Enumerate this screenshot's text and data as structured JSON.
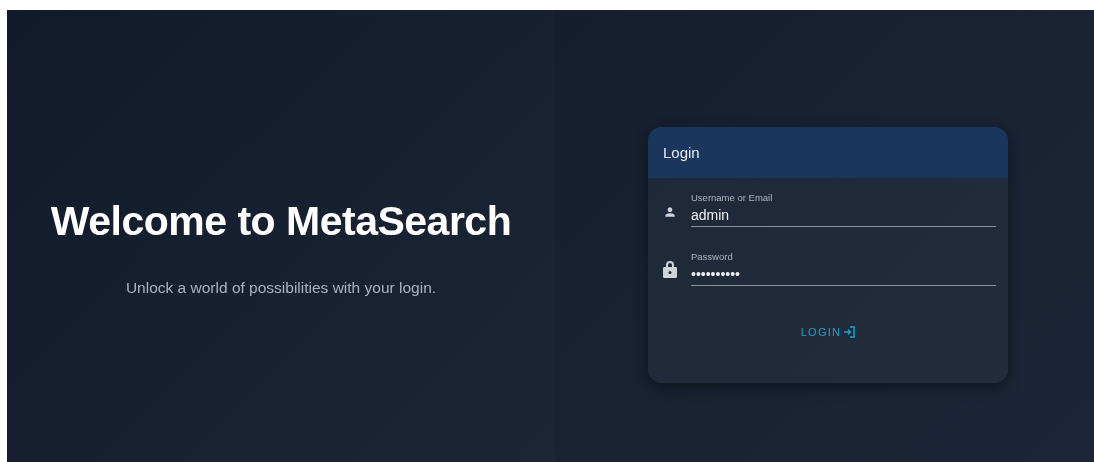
{
  "hero": {
    "title": "Welcome to MetaSearch",
    "subtitle": "Unlock a world of possibilities with your login."
  },
  "login_card": {
    "title": "Login",
    "fields": [
      {
        "kind": "user",
        "label": "Username or Email",
        "value": "admin"
      },
      {
        "kind": "password",
        "label": "Password",
        "value": "••••••••••"
      }
    ],
    "button": "LOGIN"
  }
}
